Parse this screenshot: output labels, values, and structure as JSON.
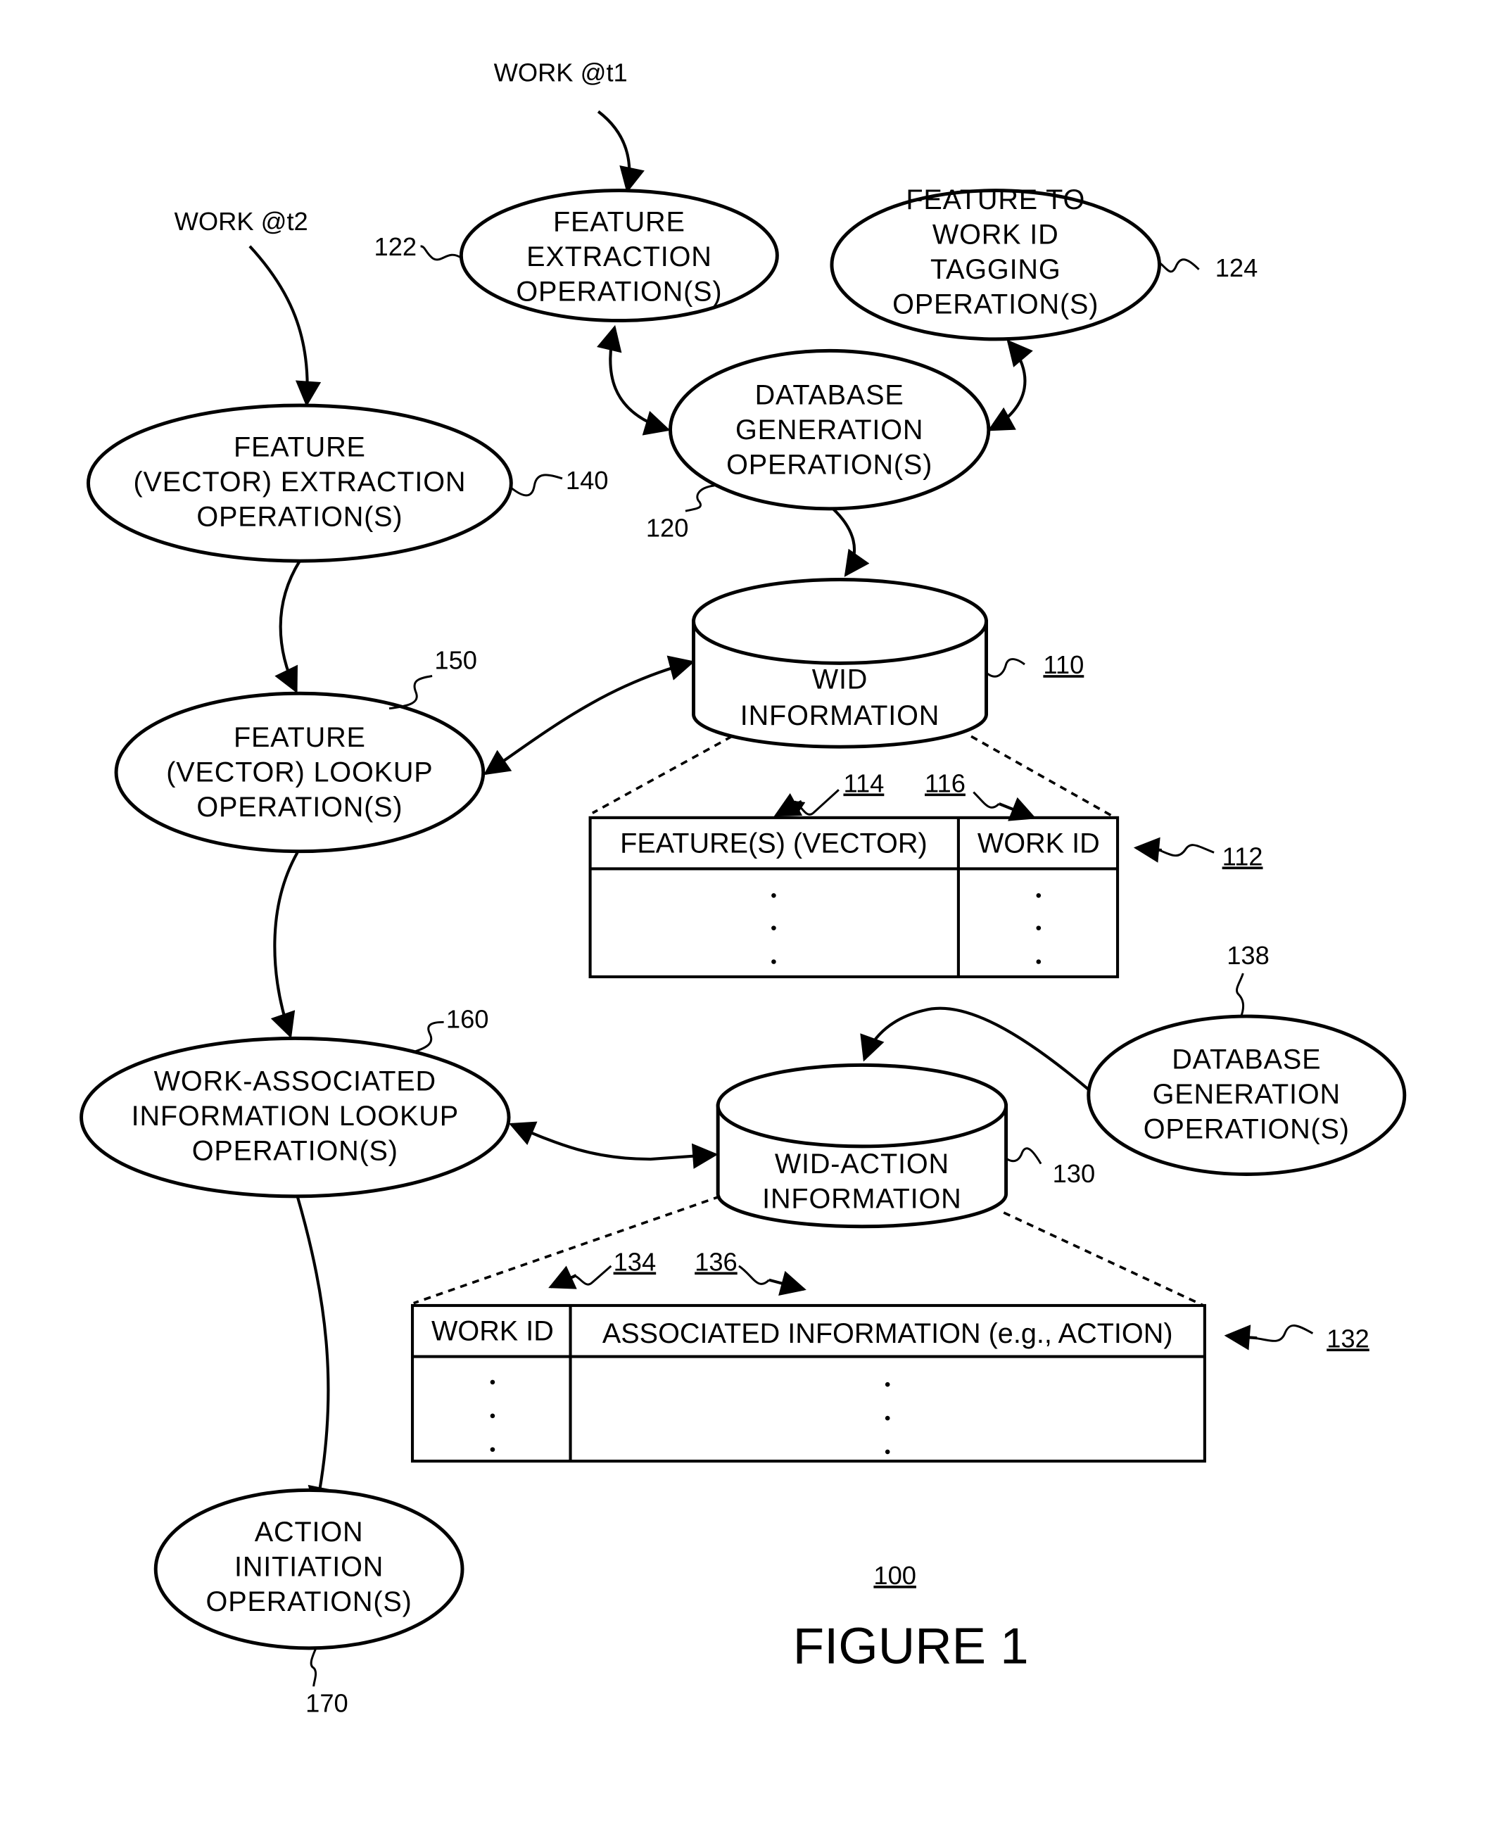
{
  "figure": {
    "title": "FIGURE 1",
    "ref": "100"
  },
  "inputs": {
    "work_t1": "WORK @t1",
    "work_t2": "WORK @t2"
  },
  "nodes": {
    "n122": {
      "ref": "122",
      "lines": [
        "FEATURE",
        "EXTRACTION",
        "OPERATION(S)"
      ]
    },
    "n124": {
      "ref": "124",
      "lines": [
        "FEATURE TO",
        "WORK ID",
        "TAGGING",
        "OPERATION(S)"
      ]
    },
    "n120": {
      "ref": "120",
      "lines": [
        "DATABASE",
        "GENERATION",
        "OPERATION(S)"
      ]
    },
    "n140": {
      "ref": "140",
      "lines": [
        "FEATURE",
        "(VECTOR) EXTRACTION",
        "OPERATION(S)"
      ]
    },
    "n150": {
      "ref": "150",
      "lines": [
        "FEATURE",
        "(VECTOR) LOOKUP",
        "OPERATION(S)"
      ]
    },
    "n160": {
      "ref": "160",
      "lines": [
        "WORK-ASSOCIATED",
        "INFORMATION LOOKUP",
        "OPERATION(S)"
      ]
    },
    "n138": {
      "ref": "138",
      "lines": [
        "DATABASE",
        "GENERATION",
        "OPERATION(S)"
      ]
    },
    "n170": {
      "ref": "170",
      "lines": [
        "ACTION",
        "INITIATION",
        "OPERATION(S)"
      ]
    }
  },
  "databases": {
    "db110": {
      "ref": "110",
      "lines": [
        "WID",
        "INFORMATION"
      ]
    },
    "db130": {
      "ref": "130",
      "lines": [
        "WID-ACTION",
        "INFORMATION"
      ]
    }
  },
  "tables": {
    "t112": {
      "ref": "112",
      "columns": [
        {
          "ref": "114",
          "header": "FEATURE(S) (VECTOR)"
        },
        {
          "ref": "116",
          "header": "WORK ID"
        }
      ],
      "rows": [
        "·",
        "·",
        "·"
      ]
    },
    "t132": {
      "ref": "132",
      "columns": [
        {
          "ref": "134",
          "header": "WORK ID"
        },
        {
          "ref": "136",
          "header": "ASSOCIATED INFORMATION (e.g., ACTION)"
        }
      ],
      "rows": [
        "·",
        "·",
        "·"
      ]
    }
  }
}
